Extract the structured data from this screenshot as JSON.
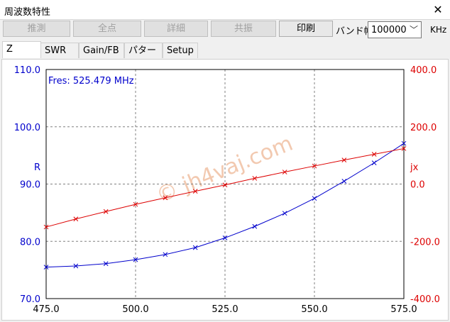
{
  "window": {
    "title": "周波数特性",
    "close_glyph": "✕"
  },
  "toolbar": {
    "buttons": [
      {
        "label": "推測",
        "enabled": false
      },
      {
        "label": "全点",
        "enabled": false
      },
      {
        "label": "詳細",
        "enabled": false
      },
      {
        "label": "共振",
        "enabled": false
      },
      {
        "label": "印刷",
        "enabled": true
      }
    ],
    "band_label": "バンド幅",
    "band_value": "100000",
    "band_unit": "KHz"
  },
  "tabs": [
    {
      "label": "Z",
      "active": true
    },
    {
      "label": "SWR",
      "active": false
    },
    {
      "label": "Gain/FB",
      "active": false
    },
    {
      "label": "パターン",
      "active": false
    },
    {
      "label": "Setup",
      "active": false
    }
  ],
  "colors": {
    "r_series": "#0000cc",
    "jx_series": "#dd0000",
    "grid": "#808080",
    "watermark": "#f2c9b0"
  },
  "watermark": "© jh4vaj.com",
  "chart_data": {
    "type": "line",
    "annotation": "Fres: 525.479 MHz",
    "x": [
      475.0,
      483.3,
      491.7,
      500.0,
      508.3,
      516.7,
      525.0,
      533.3,
      541.7,
      550.0,
      558.3,
      566.7,
      575.0
    ],
    "xlim": [
      475.0,
      575.0
    ],
    "x_ticks": [
      "475.0",
      "500.0",
      "525.0",
      "550.0",
      "575.0"
    ],
    "grid": true,
    "series": [
      {
        "name": "R",
        "axis": "left",
        "ylim": [
          70.0,
          110.0
        ],
        "y_ticks": [
          "110.0",
          "100.0",
          "90.0",
          "80.0",
          "70.0"
        ],
        "values": [
          75.5,
          75.7,
          76.1,
          76.8,
          77.7,
          78.9,
          80.6,
          82.6,
          84.9,
          87.5,
          90.5,
          93.7,
          97.1
        ]
      },
      {
        "name": "jx",
        "axis": "right",
        "ylim": [
          -400.0,
          400.0
        ],
        "y_ticks": [
          "400.0",
          "200.0",
          "0.0",
          "-200.0",
          "-400.0"
        ],
        "values": [
          -150.0,
          -122.0,
          -96.0,
          -71.0,
          -48.0,
          -25.0,
          -3.0,
          20.0,
          42.0,
          63.0,
          84.0,
          104.0,
          124.0
        ]
      }
    ]
  }
}
